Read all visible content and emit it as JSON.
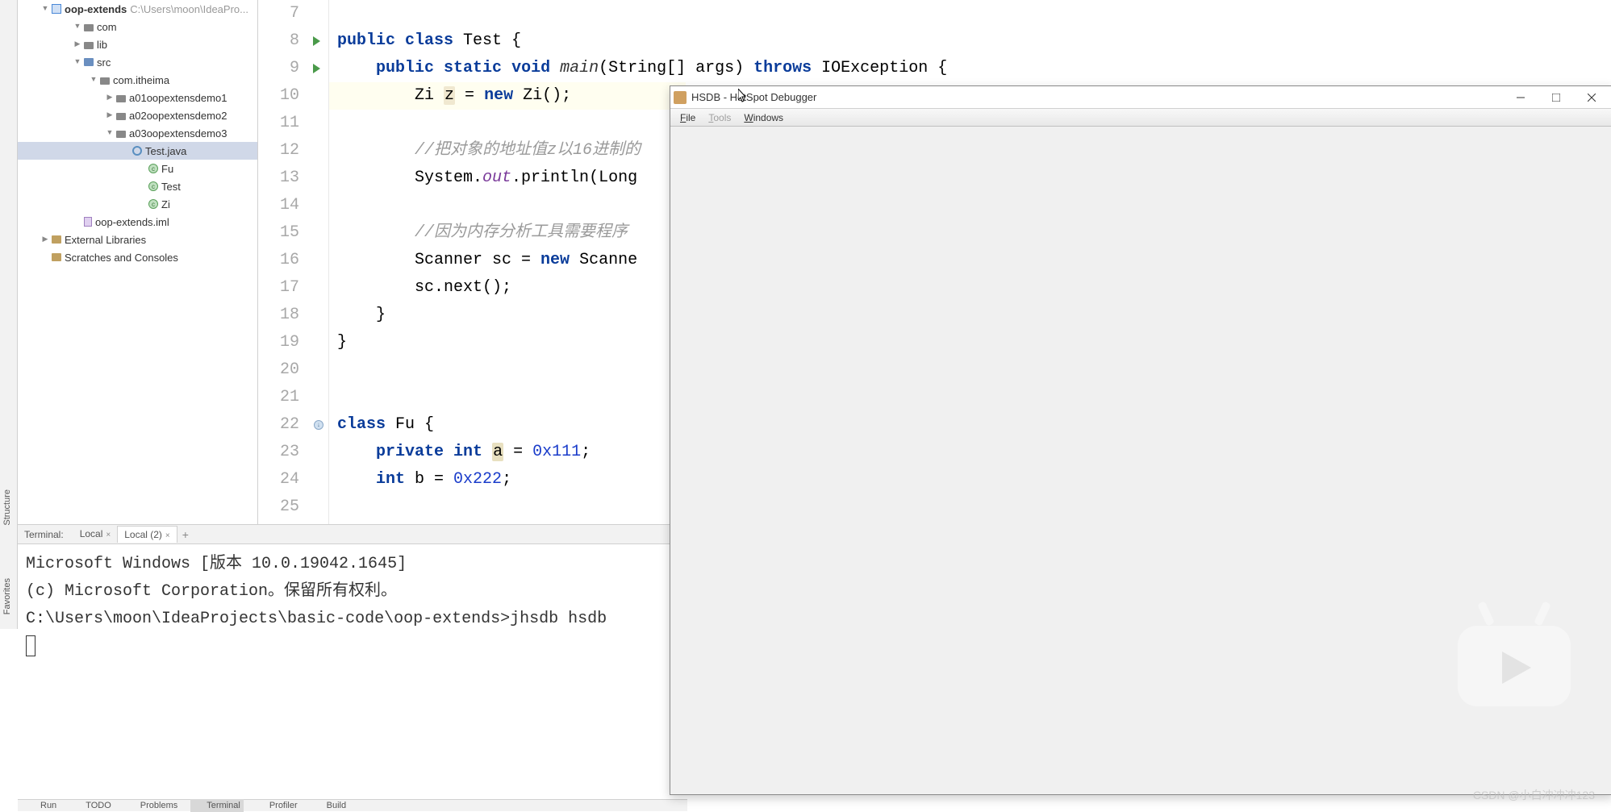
{
  "project": {
    "root_name": "oop-extends",
    "root_path": "C:\\Users\\moon\\IdeaPro...",
    "tree": [
      {
        "indent": 2,
        "expand": "down",
        "icon": "folder",
        "label": "com"
      },
      {
        "indent": 2,
        "expand": "right",
        "icon": "folder",
        "label": "lib"
      },
      {
        "indent": 2,
        "expand": "down",
        "icon": "src",
        "label": "src"
      },
      {
        "indent": 3,
        "expand": "down",
        "icon": "folder",
        "label": "com.itheima"
      },
      {
        "indent": 4,
        "expand": "right",
        "icon": "folder",
        "label": "a01oopextensdemo1"
      },
      {
        "indent": 4,
        "expand": "right",
        "icon": "folder",
        "label": "a02oopextensdemo2"
      },
      {
        "indent": 4,
        "expand": "down",
        "icon": "folder",
        "label": "a03oopextensdemo3"
      },
      {
        "indent": 5,
        "expand": "none",
        "icon": "java",
        "label": "Test.java",
        "selected": true
      },
      {
        "indent": 6,
        "expand": "none",
        "icon": "class",
        "label": "Fu"
      },
      {
        "indent": 6,
        "expand": "none",
        "icon": "class",
        "label": "Test"
      },
      {
        "indent": 6,
        "expand": "none",
        "icon": "class",
        "label": "Zi"
      },
      {
        "indent": 2,
        "expand": "none",
        "icon": "iml",
        "label": "oop-extends.iml"
      },
      {
        "indent": 0,
        "expand": "right",
        "icon": "lib",
        "label": "External Libraries"
      },
      {
        "indent": 0,
        "expand": "none",
        "icon": "lib",
        "label": "Scratches and Consoles"
      }
    ]
  },
  "editor": {
    "lines": [
      {
        "n": 7,
        "gutter": "",
        "code": ""
      },
      {
        "n": 8,
        "gutter": "run",
        "code_html": "<span class='kw'>public</span> <span class='kw'>class</span> Test {"
      },
      {
        "n": 9,
        "gutter": "run",
        "code_html": "    <span class='kw'>public</span> <span class='kw'>static</span> <span class='kw'>void</span> <span class='mtd'>main</span>(String[] args) <span class='kw'>throws</span> IOException {"
      },
      {
        "n": 10,
        "gutter": "",
        "hl": true,
        "code_html": "        Zi <span class='hl-var'>z</span> = <span class='kw'>new</span> Zi();"
      },
      {
        "n": 11,
        "gutter": "",
        "code": ""
      },
      {
        "n": 12,
        "gutter": "",
        "code_html": "        <span class='cmt'>//把对象的地址值z以16进制的</span>"
      },
      {
        "n": 13,
        "gutter": "",
        "code_html": "        System.<span class='fld'>out</span>.println(Long"
      },
      {
        "n": 14,
        "gutter": "",
        "code": ""
      },
      {
        "n": 15,
        "gutter": "",
        "code_html": "        <span class='cmt'>//因为内存分析工具需要程序</span>"
      },
      {
        "n": 16,
        "gutter": "",
        "code_html": "        Scanner sc = <span class='kw'>new</span> Scanne"
      },
      {
        "n": 17,
        "gutter": "",
        "code_html": "        sc.next();"
      },
      {
        "n": 18,
        "gutter": "",
        "code_html": "    }"
      },
      {
        "n": 19,
        "gutter": "",
        "code_html": "}"
      },
      {
        "n": 20,
        "gutter": "",
        "code": ""
      },
      {
        "n": 21,
        "gutter": "",
        "code": ""
      },
      {
        "n": 22,
        "gutter": "usage",
        "code_html": "<span class='kw'>class</span> Fu {"
      },
      {
        "n": 23,
        "gutter": "",
        "code_html": "    <span class='kw'>private</span> <span class='kw'>int</span> <span class='hl-a'>a</span> = <span class='num'>0x111</span>;"
      },
      {
        "n": 24,
        "gutter": "",
        "code_html": "    <span class='kw'>int</span> b = <span class='num'>0x222</span>;"
      },
      {
        "n": 25,
        "gutter": "",
        "code": ""
      }
    ]
  },
  "terminal": {
    "label": "Terminal:",
    "tabs": [
      {
        "name": "Local",
        "active": false
      },
      {
        "name": "Local (2)",
        "active": true
      }
    ],
    "lines": [
      "Microsoft Windows [版本 10.0.19042.1645]",
      "(c) Microsoft Corporation。保留所有权利。",
      "",
      "C:\\Users\\moon\\IdeaProjects\\basic-code\\oop-extends>jhsdb hsdb"
    ]
  },
  "bottom": {
    "items": [
      {
        "label": "Run"
      },
      {
        "label": "TODO"
      },
      {
        "label": "Problems"
      },
      {
        "label": "Terminal",
        "active": true
      },
      {
        "label": "Profiler"
      },
      {
        "label": "Build"
      }
    ]
  },
  "hsdb": {
    "title": "HSDB - HotSpot Debugger",
    "menus": [
      {
        "label": "File",
        "mn": "F",
        "disabled": false
      },
      {
        "label": "Tools",
        "mn": "T",
        "disabled": true
      },
      {
        "label": "Windows",
        "mn": "W",
        "disabled": false
      }
    ]
  },
  "sidetabs": {
    "structure": "Structure",
    "favorites": "Favorites"
  },
  "watermark": "CSDN @小白冲冲冲123"
}
